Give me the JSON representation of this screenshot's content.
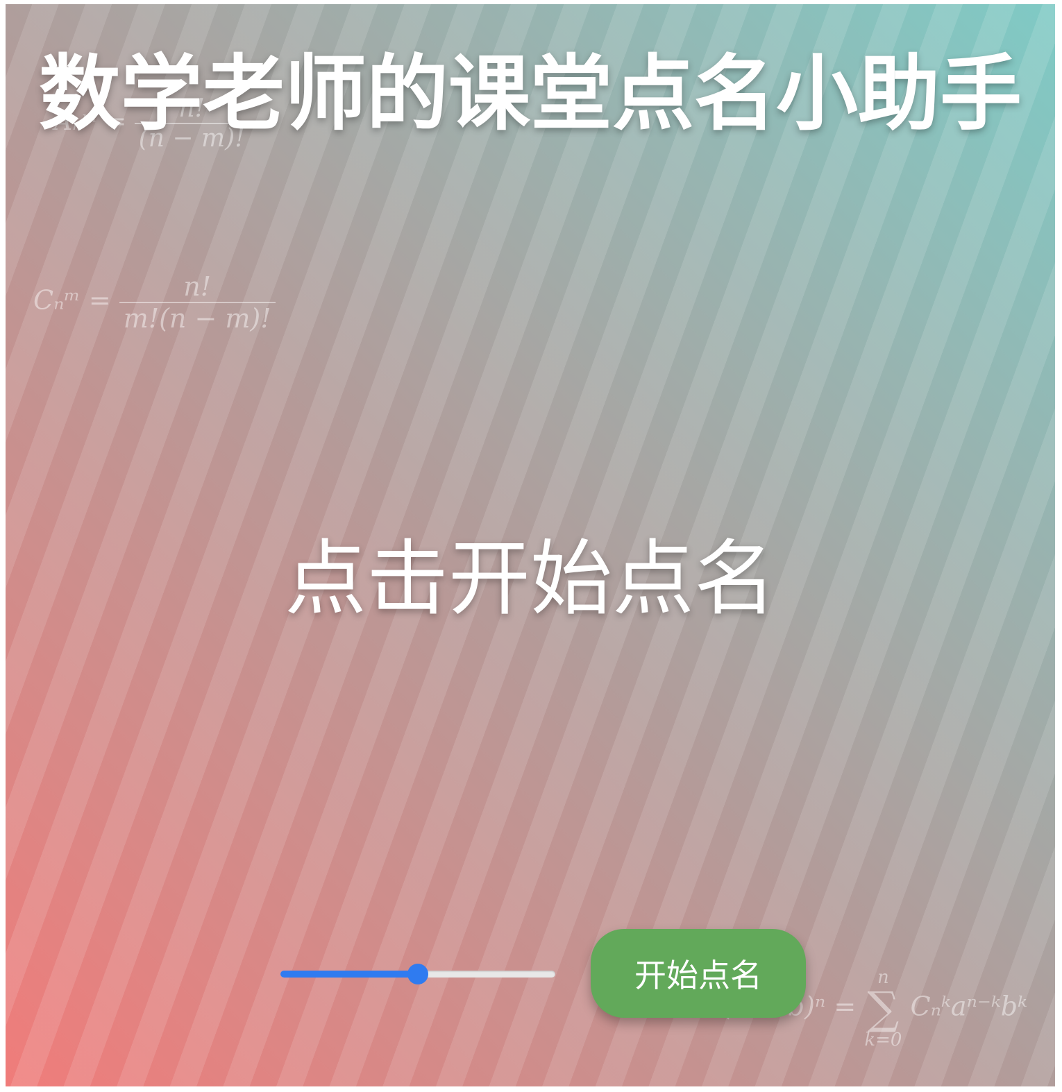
{
  "header": {
    "title": "数学老师的课堂点名小助手"
  },
  "main": {
    "prompt": "点击开始点名"
  },
  "controls": {
    "slider_value_fraction": 0.5,
    "slider_color": "#2f7bf0",
    "start_button_label": "开始点名",
    "start_button_color": "#62a95a"
  },
  "background": {
    "gradient_colors": [
      "#f07c7a",
      "#b29c9a",
      "#7fcac5"
    ],
    "formulas": {
      "permutation": {
        "lhs": "Aₙᵐ =",
        "num": "n!",
        "den": "(n − m)!"
      },
      "combination": {
        "lhs": "Cₙᵐ =",
        "num": "n!",
        "den": "m!(n − m)!"
      },
      "binomial": {
        "lhs": "(a + b)ⁿ =",
        "sum_top": "n",
        "sum_symbol": "∑",
        "sum_bottom": "k=0",
        "rhs": "Cₙᵏaⁿ⁻ᵏbᵏ"
      }
    }
  }
}
